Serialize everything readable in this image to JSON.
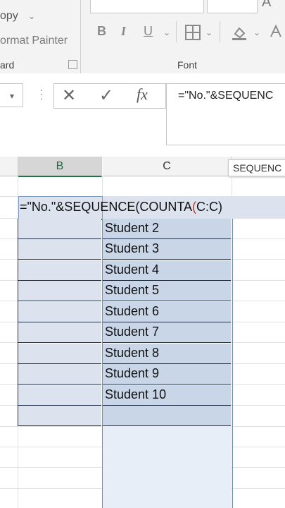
{
  "ribbon": {
    "copy_label": "opy",
    "format_painter_label": "ormat Painter",
    "clipboard_group_label": "ard",
    "font_group_label": "Font",
    "font_top_glyph": "A",
    "bold_label": "B",
    "italic_label": "I",
    "underline_label": "U",
    "dropdown_glyph": "⌄"
  },
  "formula_bar": {
    "namebox_arrow": "▾",
    "cancel_glyph": "✕",
    "enter_glyph": "✓",
    "fx_label": "fx",
    "formula_text": "=\"No.\"&SEQUENC"
  },
  "columns": {
    "b_label": "B",
    "c_label": "C"
  },
  "tooltip_text": "SEQUENC",
  "edit": {
    "formula_before": "=\"No.\"&SEQUENCE(COUNTA",
    "formula_paren": "(",
    "formula_after": "C:C)"
  },
  "c_column_values": [
    "Student 2",
    "Student 3",
    "Student 4",
    "Student 5",
    "Student 6",
    "Student 7",
    "Student 8",
    "Student 9",
    "Student 10",
    ""
  ],
  "colors": {
    "selected_fill": "#c9d6e8",
    "edit_fill": "#dce3ef",
    "header_accent": "#217346"
  }
}
